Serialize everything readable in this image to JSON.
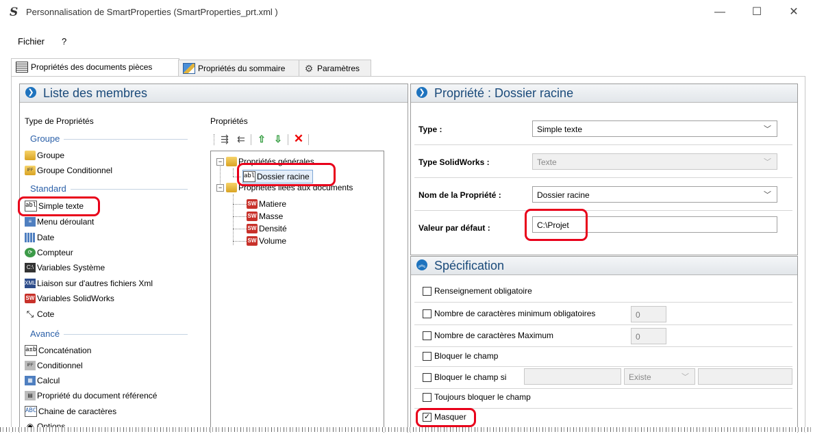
{
  "window": {
    "title": "Personnalisation de SmartProperties (SmartProperties_prt.xml )",
    "minimize": "—",
    "maximize": "☐",
    "close": "✕"
  },
  "menu": {
    "items": [
      "Fichier",
      "?"
    ]
  },
  "tabs": [
    {
      "label": "Propriétés des documents pièces",
      "icon": "properties-list-icon",
      "active": true
    },
    {
      "label": "Propriétés du sommaire",
      "icon": "edit-pencil-icon",
      "active": false
    },
    {
      "label": "Paramètres",
      "icon": "gear-icon",
      "active": false
    }
  ],
  "members_panel": {
    "title": "Liste des membres",
    "types_title": "Type de Propriétés",
    "sections": {
      "groupe": {
        "title": "Groupe",
        "items": [
          "Groupe",
          "Groupe Conditionnel"
        ]
      },
      "standard": {
        "title": "Standard",
        "items": [
          "Simple texte",
          "Menu déroulant",
          "Date",
          "Compteur",
          "Variables Système",
          "Liaison sur d'autres fichiers Xml",
          "Variables SolidWorks",
          "Cote"
        ]
      },
      "avance": {
        "title": "Avancé",
        "items": [
          "Concaténation",
          "Conditionnel",
          "Calcul",
          "Propriété du document référencé",
          "Chaine de caractères",
          "Options"
        ]
      }
    },
    "properties_title": "Propriétés",
    "tree": {
      "general": {
        "label": "Propriétés générales",
        "children": [
          "Dossier racine"
        ]
      },
      "documents": {
        "label": "Propriétés liées aux documents",
        "children": [
          "Matiere",
          "Masse",
          "Densité",
          "Volume"
        ]
      }
    }
  },
  "property_panel": {
    "title": "Propriété : Dossier racine",
    "type_label": "Type :",
    "type_value": "Simple texte",
    "sw_type_label": "Type SolidWorks :",
    "sw_type_value": "Texte",
    "name_label": "Nom de la Propriété :",
    "name_value": "Dossier racine",
    "default_label": "Valeur par défaut :",
    "default_value": "C:\\Projet"
  },
  "spec_panel": {
    "title": "Spécification",
    "required": {
      "label": "Renseignement obligatoire",
      "checked": false
    },
    "min_chars": {
      "label": "Nombre de caractères minimum obligatoires",
      "value": "0",
      "checked": false
    },
    "max_chars": {
      "label": "Nombre de caractères Maximum",
      "value": "0",
      "checked": false
    },
    "lock": {
      "label": "Bloquer le champ",
      "checked": false
    },
    "lock_if": {
      "label": "Bloquer le champ si",
      "operator": "Existe",
      "checked": false
    },
    "always_lock": {
      "label": "Toujours bloquer le champ",
      "checked": false
    },
    "hide": {
      "label": "Masquer",
      "checked": true,
      "mark": "✓"
    }
  },
  "colors": {
    "accent": "#1e73be",
    "highlight_ring": "#e8001a",
    "header_text": "#1a4a7a",
    "section_text": "#2a5fa8"
  }
}
